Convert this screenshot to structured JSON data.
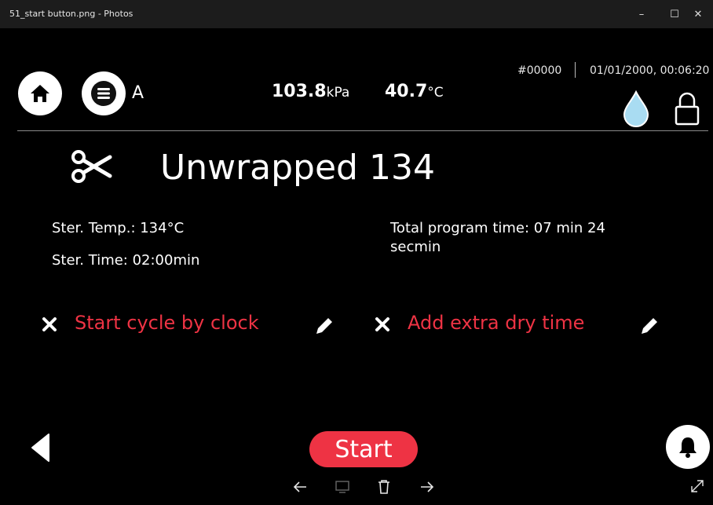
{
  "window": {
    "title": "51_start button.png - Photos",
    "minimize_glyph": "–",
    "maximize_glyph": "☐",
    "close_glyph": "✕"
  },
  "header": {
    "home_icon": "home-icon",
    "menu_icon": "menu-icon",
    "profile_letter": "A",
    "pressure_value": "103.8",
    "pressure_unit": "kPa",
    "temperature_value": "40.7",
    "temperature_unit": "°C",
    "serial": "#00000",
    "datetime": "01/01/2000, 00:06:20",
    "water_icon": "water-drop-icon",
    "lock_icon": "lock-icon"
  },
  "program": {
    "icon": "scissors-icon",
    "name": "Unwrapped 134",
    "ster_temp": "Ster. Temp.: 134°C",
    "ster_time": "Ster. Time: 02:00min",
    "total_time_line1": "Total program time: 07 min 24",
    "total_time_line2": "secmin"
  },
  "options": {
    "start_by_clock": "Start cycle by clock",
    "extra_dry_time": "Add extra dry time"
  },
  "footer": {
    "start_label": "Start"
  },
  "colors": {
    "accent": "#ee3344",
    "background": "#000000",
    "titlebar": "#1c1c1c",
    "drop": "#a9dcf2"
  }
}
